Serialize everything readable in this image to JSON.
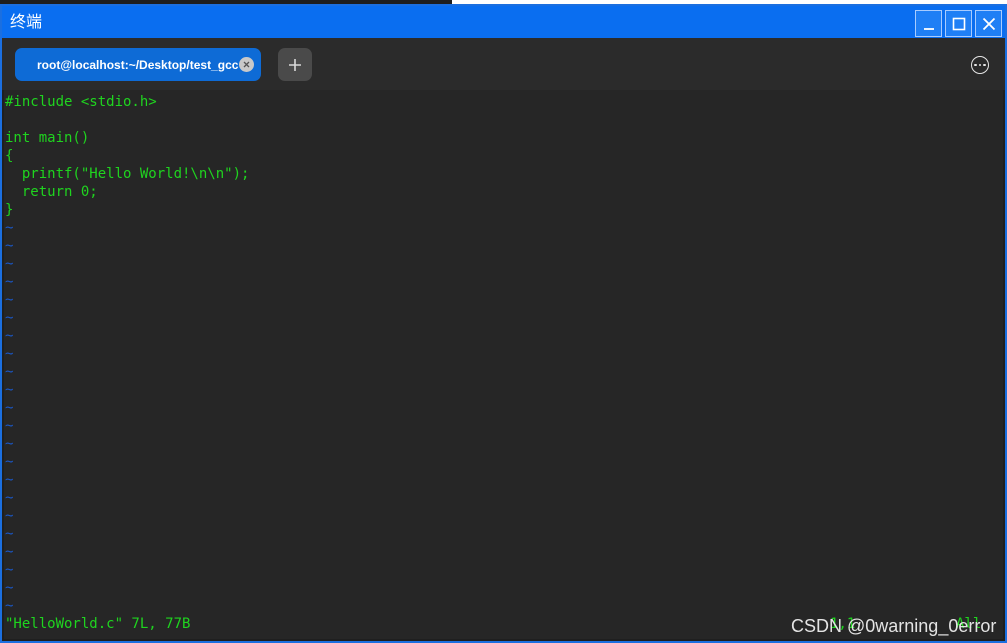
{
  "window": {
    "title": "终端",
    "controls": {
      "minimize_icon": "minimize-icon",
      "maximize_icon": "maximize-icon",
      "close_icon": "close-icon"
    }
  },
  "tabs": [
    {
      "label": "root@localhost:~/Desktop/test_gcc",
      "active": true
    }
  ],
  "tabbar": {
    "new_tab_icon": "plus-icon",
    "menu_icon": "more-options-icon"
  },
  "editor": {
    "code_lines": [
      "#include <stdio.h>",
      "",
      "int main()",
      "{",
      "  printf(\"Hello World!\\n\\n\");",
      "  return 0;",
      "}"
    ],
    "empty_line_marker": "~",
    "empty_line_count": 22,
    "status_message": "\"HelloWorld.c\" 7L, 77B",
    "cursor_position": "1,1",
    "scroll_position": "All"
  },
  "watermark": "CSDN @0warning_0error",
  "colors": {
    "titlebar": "#0a6ef0",
    "tab_active": "#0e6bd6",
    "editor_bg": "#262626",
    "code_text": "#1fd41f",
    "tilde": "#1a58c8"
  }
}
